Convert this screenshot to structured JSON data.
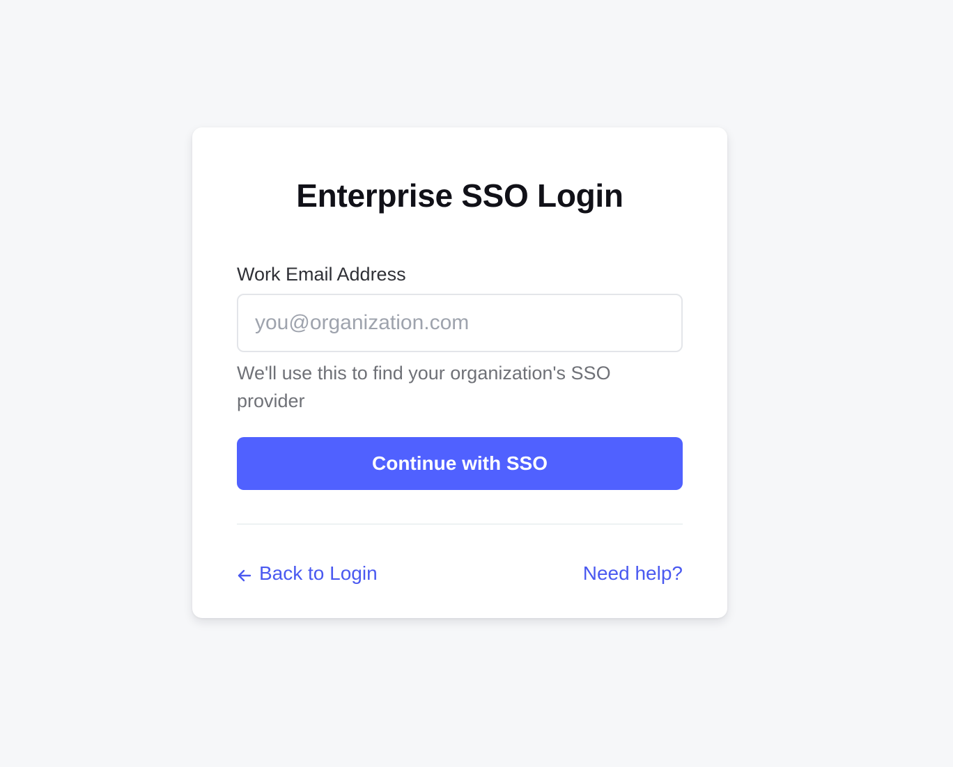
{
  "login": {
    "title": "Enterprise SSO Login",
    "email_label": "Work Email Address",
    "email_placeholder": "you@organization.com",
    "email_value": "",
    "helper_text": "We'll use this to find your organization's SSO provider",
    "submit_label": "Continue with SSO",
    "back_label": "Back to Login",
    "back_icon": "arrow-left-icon",
    "help_label": "Need help?"
  },
  "colors": {
    "page_background": "#f6f7f9",
    "card_background": "#ffffff",
    "accent": "#5061ff",
    "link": "#4a59f0",
    "title_text": "#111118",
    "helper_text": "#6f7177",
    "placeholder_text": "#9ea3ad"
  }
}
